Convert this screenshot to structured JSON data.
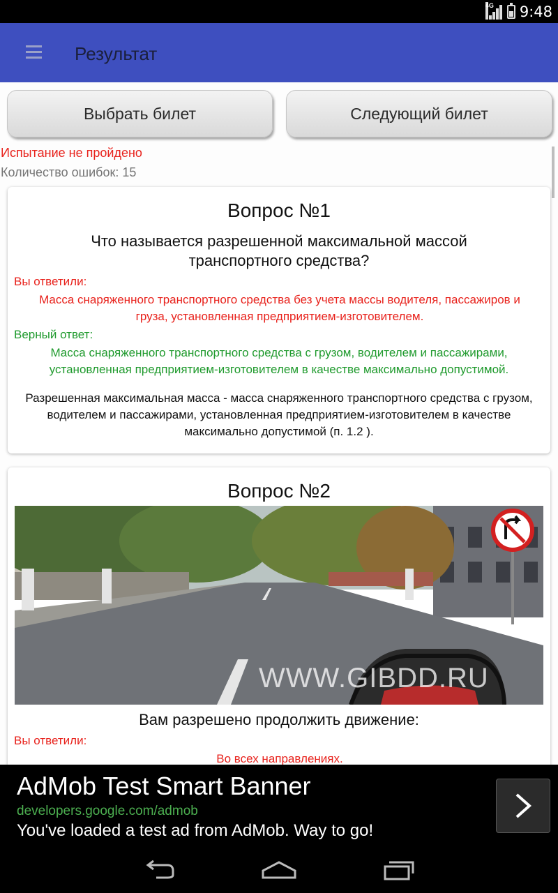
{
  "status_bar": {
    "time": "9:48",
    "network": "4G"
  },
  "app_bar": {
    "title": "Результат",
    "menu_icon": "hamburger-menu-icon"
  },
  "buttons": {
    "select_ticket": "Выбрать билет",
    "next_ticket": "Следующий билет"
  },
  "result": {
    "status": "Испытание не пройдено",
    "errors": "Количество ошибок: 15"
  },
  "questions": [
    {
      "title": "Вопрос №1",
      "text": "Что называется разрешенной максимальной массой транспортного средства?",
      "your_answer_label": "Вы ответили:",
      "your_answer": "Масса снаряженного транспортного средства без учета массы водителя, пассажиров и груза, установленная предприятием-изготовителем.",
      "correct_label": "Верный ответ:",
      "correct_answer": "Масса снаряженного транспортного средства с грузом, водителем и пассажирами, установленная предприятием-изготовителем в качестве максимально допустимой.",
      "explanation": "Разрешенная максимальная масса - масса снаряженного транспортного средства с грузом, водителем и пассажирами, установленная предприятием-изготовителем в качестве максимально допустимой (п. 1.2 )."
    },
    {
      "title": "Вопрос №2",
      "image_watermark": "WWW.GIBDD.RU",
      "text": "Вам разрешено продолжить движение:",
      "your_answer_label": "Вы ответили:",
      "your_answer": "Во всех направлениях."
    }
  ],
  "ad": {
    "title": "AdMob Test Smart Banner",
    "url": "developers.google.com/admob",
    "description": "You've loaded a test ad from AdMob. Way to go!"
  },
  "colors": {
    "app_bar": "#3e4fbf",
    "error_red": "#e8221c",
    "correct_green": "#1f9a2d"
  }
}
